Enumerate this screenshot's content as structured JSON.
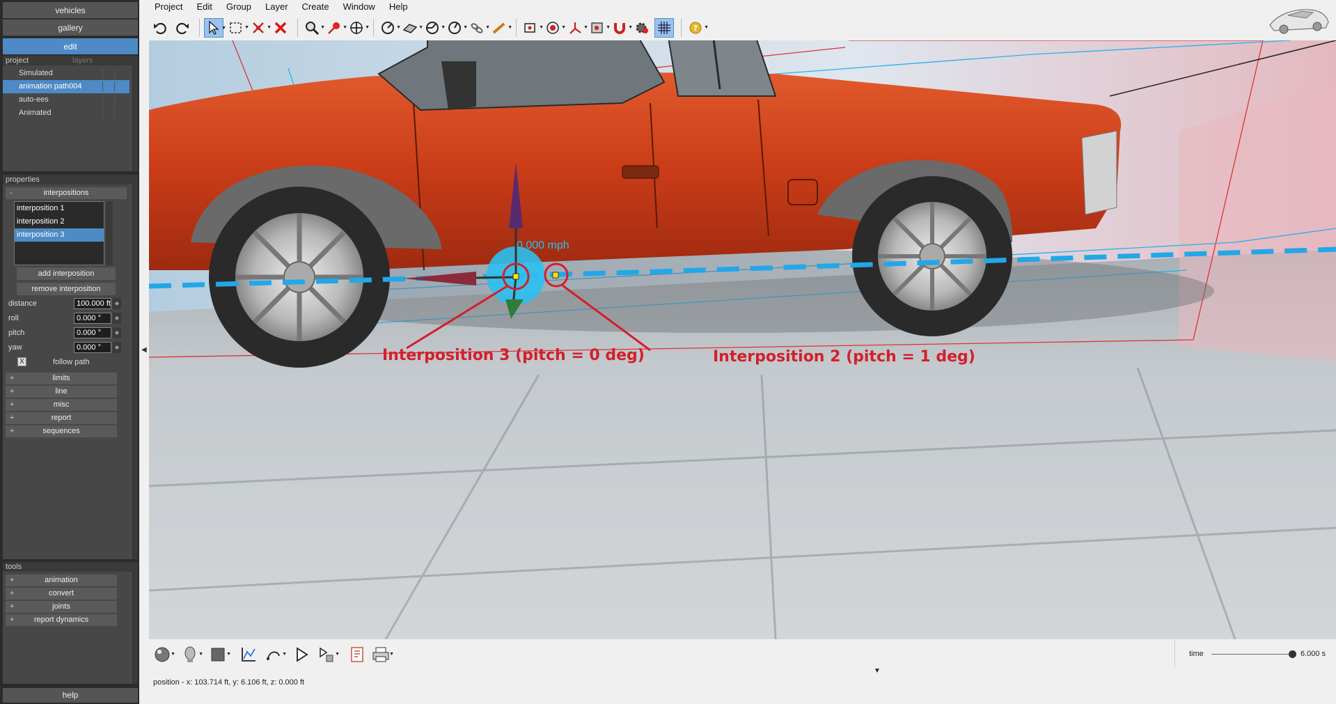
{
  "left_panel": {
    "top_buttons": {
      "vehicles": "vehicles",
      "gallery": "gallery",
      "edit": "edit"
    },
    "project_pane": {
      "tab_project": "project",
      "tab_layers": "layers",
      "items": [
        "Simulated",
        "animation path004",
        "auto-ees",
        "Animated"
      ],
      "selected": "animation path004"
    },
    "properties_pane": {
      "title": "properties",
      "interpositions_header": "interpositions",
      "interpositions": [
        "interposition 1",
        "interposition 2",
        "interposition 3"
      ],
      "selected_interposition": "interposition 3",
      "add_button": "add interposition",
      "remove_button": "remove interposition",
      "fields": {
        "distance": {
          "label": "distance",
          "value": "100.000 ft"
        },
        "roll": {
          "label": "roll",
          "value": "0.000 °"
        },
        "pitch": {
          "label": "pitch",
          "value": "0.000 °"
        },
        "yaw": {
          "label": "yaw",
          "value": "0.000 °"
        }
      },
      "follow_path": {
        "label": "follow path",
        "checked": true,
        "mark": "X"
      },
      "sections": [
        "limits",
        "line",
        "misc",
        "report",
        "sequences"
      ],
      "expand_glyph": "+",
      "collapse_glyph": "-"
    },
    "tools_pane": {
      "title": "tools",
      "sections": [
        "animation",
        "convert",
        "joints",
        "report dynamics"
      ]
    },
    "help_button": "help"
  },
  "menu": [
    "Project",
    "Edit",
    "Group",
    "Layer",
    "Create",
    "Window",
    "Help"
  ],
  "toolbar_icons": [
    "undo-icon",
    "redo-icon",
    "select-arrow-icon",
    "select-box-icon",
    "unlink-icon",
    "delete-x-icon",
    "zoom-icon",
    "pin-icon",
    "move-icon",
    "measure-icon",
    "plane-icon",
    "angle-icon",
    "angle2-icon",
    "chain-icon",
    "wrench-icon",
    "camera-icon",
    "target-icon",
    "axis-icon",
    "snapshot-icon",
    "magnet-icon",
    "gear-icon",
    "grid-icon",
    "help-icon"
  ],
  "viewport": {
    "speed_label": "0.000 mph",
    "annotations": {
      "left": "Interposition 3 (pitch = 0 deg)",
      "right": "Interposition 2 (pitch = 1 deg)"
    },
    "colors": {
      "vehicle": "#c9401c",
      "annotation": "#d41f2a",
      "path": "#22a7e8"
    }
  },
  "bottom_bar": {
    "status_text": "position - x: 103.714 ft, y: 6.106 ft, z: 0.000 ft",
    "time_label": "time",
    "time_value": "6.000 s",
    "time_fraction": 0.97
  }
}
